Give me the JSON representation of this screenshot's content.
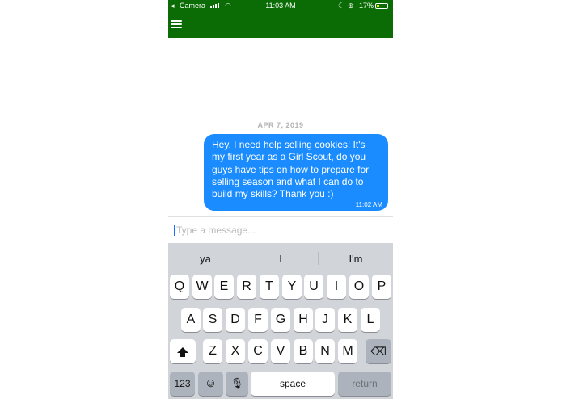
{
  "status_bar": {
    "back_icon": "back-arrow-icon",
    "carrier": "Camera",
    "time": "11:03 AM",
    "battery_percent": "17%",
    "background_color": "#0b6b05"
  },
  "navbar": {
    "menu_icon": "hamburger-menu-icon",
    "background_color": "#0b6b05"
  },
  "chat": {
    "date": "APR 7, 2019",
    "messages": [
      {
        "text": "Hey, I need help selling cookies! It's my first year as a Girl Scout, do you guys have tips on how to prepare for selling season and what I can do to build my skills? Thank you :)",
        "time": "11:02 AM",
        "bubble_color": "#1a8cff"
      }
    ]
  },
  "composer": {
    "placeholder": "Type a message..."
  },
  "keyboard": {
    "suggestions": [
      "ya",
      "I",
      "I'm"
    ],
    "row1": [
      "Q",
      "W",
      "E",
      "R",
      "T",
      "Y",
      "U",
      "I",
      "O",
      "P"
    ],
    "row2": [
      "A",
      "S",
      "D",
      "F",
      "G",
      "H",
      "J",
      "K",
      "L"
    ],
    "row3": [
      "Z",
      "X",
      "C",
      "V",
      "B",
      "N",
      "M"
    ],
    "numbers_key": "123",
    "space_key": "space",
    "return_key": "return"
  }
}
